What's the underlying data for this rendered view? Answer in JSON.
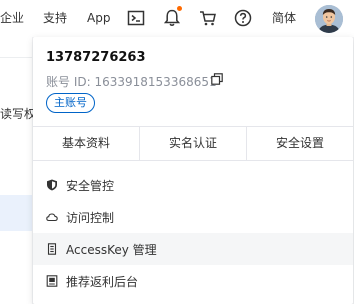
{
  "topbar": {
    "enterprise": "企业",
    "support": "支持",
    "app": "App",
    "language": "简体",
    "icons": [
      "terminal-icon",
      "bell-icon",
      "cart-icon",
      "help-icon"
    ]
  },
  "background": {
    "partial_text": "读写权"
  },
  "account_panel": {
    "phone": "13787276263",
    "account_id_label": "账号 ID:",
    "account_id": "1633918153368651",
    "badge": "主账号",
    "tabs": [
      {
        "label": "基本资料"
      },
      {
        "label": "实名认证"
      },
      {
        "label": "安全设置"
      }
    ],
    "menu": [
      {
        "label": "安全管控",
        "icon": "shield-icon"
      },
      {
        "label": "访问控制",
        "icon": "cloud-icon"
      },
      {
        "label": "AccessKey 管理",
        "icon": "key-icon"
      },
      {
        "label": "推荐返利后台",
        "icon": "rebate-icon"
      }
    ]
  },
  "colors": {
    "accent": "#0064c8",
    "notification_dot": "#ff6a00",
    "hover_row": "#f5f6f7"
  }
}
